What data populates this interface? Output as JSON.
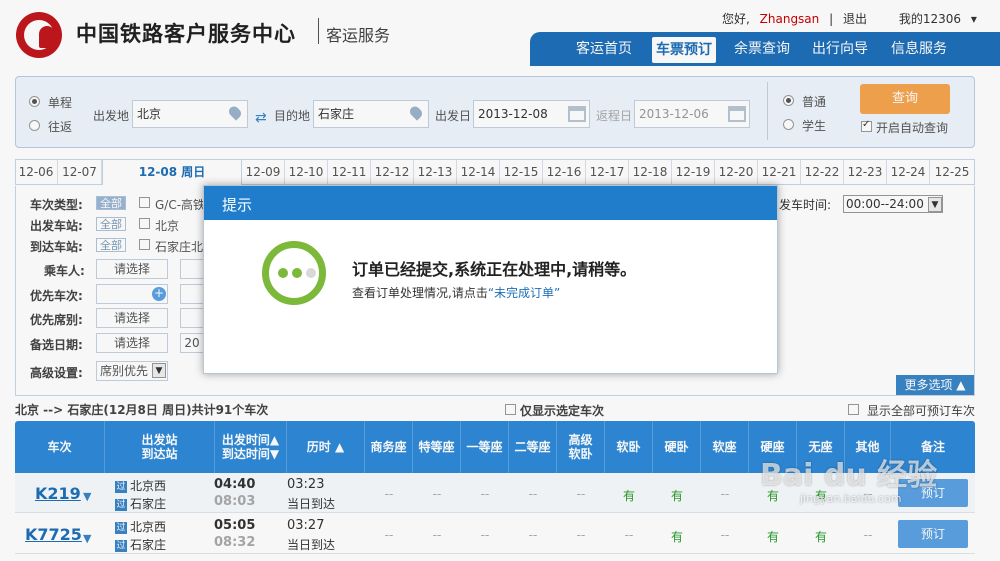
{
  "header": {
    "brand": "中国铁路客户服务中心",
    "sub": "客运服务",
    "greeting": "您好,",
    "user": "Zhangsan",
    "sep": "|",
    "logout": "退出",
    "account": "我的12306",
    "nav": [
      "客运首页",
      "车票预订",
      "余票查询",
      "出行向导",
      "信息服务"
    ]
  },
  "query": {
    "trip_oneway": "单程",
    "trip_round": "往返",
    "from_label": "出发地",
    "from_value": "北京",
    "to_label": "目的地",
    "to_value": "石家庄",
    "depart_label": "出发日",
    "depart_value": "2013-12-08",
    "return_label": "返程日",
    "return_value": "2013-12-06",
    "type_normal": "普通",
    "type_student": "学生",
    "query_btn": "查询",
    "auto_query": "开启自动查询"
  },
  "dates": [
    "12-06",
    "12-07",
    "12-08 周日",
    "12-09",
    "12-10",
    "12-11",
    "12-12",
    "12-13",
    "12-14",
    "12-15",
    "12-16",
    "12-17",
    "12-18",
    "12-19",
    "12-20",
    "12-21",
    "12-22",
    "12-23",
    "12-24",
    "12-25"
  ],
  "filter": {
    "train_type": "车次类型:",
    "all": "全部",
    "gc": "G/C-高铁",
    "from_station": "出发车站:",
    "from_st_opt": "北京",
    "to_station": "到达车站:",
    "to_st_opt": "石家庄北",
    "passenger": "乘车人:",
    "choose": "请选择",
    "pref_train": "优先车次:",
    "pref_seat": "优先席别:",
    "alt_date": "备选日期:",
    "alt_year": "20",
    "advanced": "高级设置:",
    "adv_opt": "席别优先",
    "depart_time": "发车时间:",
    "time_range": "00:00--24:00",
    "more": "更多选项"
  },
  "summary": {
    "route": "北京 --> 石家庄(12月8日 周日)共计91个车次",
    "only_selected": "仅显示选定车次",
    "show_bookable": "显示全部可预订车次"
  },
  "table": {
    "headers": [
      "车次",
      "出发站\n到达站",
      "出发时间▲\n到达时间▼",
      "历时 ▲",
      "商务座",
      "特等座",
      "一等座",
      "二等座",
      "高级\n软卧",
      "软卧",
      "硬卧",
      "软座",
      "硬座",
      "无座",
      "其他",
      "备注"
    ],
    "rows": [
      {
        "train": "K219",
        "from": "北京西",
        "to": "石家庄",
        "dep": "04:40",
        "arr": "08:03",
        "dur": "03:23",
        "note": "当日到达",
        "cells": [
          "--",
          "--",
          "--",
          "--",
          "--",
          "有",
          "有",
          "--",
          "有",
          "有",
          "--"
        ],
        "book": "预订"
      },
      {
        "train": "K7725",
        "from": "北京西",
        "to": "石家庄",
        "dep": "05:05",
        "arr": "08:32",
        "dur": "03:27",
        "note": "当日到达",
        "cells": [
          "--",
          "--",
          "--",
          "--",
          "--",
          "--",
          "有",
          "--",
          "有",
          "有",
          "--"
        ],
        "book": "预订"
      }
    ],
    "station_from_icon": "过",
    "station_to_icon": "过"
  },
  "modal": {
    "title": "提示",
    "message": "订单已经提交,系统正在处理中,请稍等。",
    "sub_prefix": "查看订单处理情况,请点击",
    "sub_link": "“未完成订单”"
  },
  "watermark": {
    "main": "Bai du 经验",
    "sub": "jingyan.baidu.com"
  },
  "colors": {
    "nav_blue": "#1e6fb8",
    "table_blue": "#2f8ad8",
    "query_orange": "#f6a54f",
    "ring_green": "#7cb83a",
    "available_green": "#2a9b2a"
  }
}
